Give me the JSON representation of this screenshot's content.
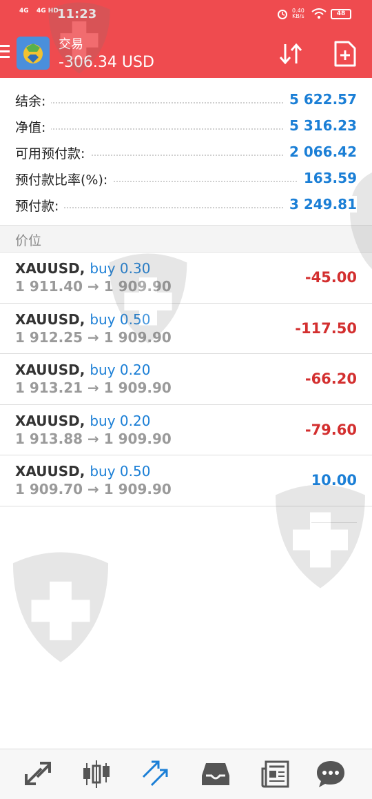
{
  "status_bar": {
    "time": "11:23",
    "network1": "4G",
    "network2": "4G HD",
    "speed_value": "0.40",
    "speed_unit": "KB/s",
    "battery": "48"
  },
  "header": {
    "title": "交易",
    "profit": "-306.34 USD",
    "accent": "#ef4b4f"
  },
  "account": [
    {
      "label": "结余:",
      "value": "5 622.57"
    },
    {
      "label": "净值:",
      "value": "5 316.23"
    },
    {
      "label": "可用预付款:",
      "value": "2 066.42"
    },
    {
      "label": "预付款比率(%):",
      "value": "163.59"
    },
    {
      "label": "预付款:",
      "value": "3 249.81"
    }
  ],
  "section_title": "价位",
  "positions": [
    {
      "symbol": "XAUUSD,",
      "side": "buy 0.30",
      "prices": "1 911.40 → 1 909.90",
      "profit": "-45.00",
      "sign": "neg"
    },
    {
      "symbol": "XAUUSD,",
      "side": "buy 0.50",
      "prices": "1 912.25 → 1 909.90",
      "profit": "-117.50",
      "sign": "neg"
    },
    {
      "symbol": "XAUUSD,",
      "side": "buy 0.20",
      "prices": "1 913.21 → 1 909.90",
      "profit": "-66.20",
      "sign": "neg"
    },
    {
      "symbol": "XAUUSD,",
      "side": "buy 0.20",
      "prices": "1 913.88 → 1 909.90",
      "profit": "-79.60",
      "sign": "neg"
    },
    {
      "symbol": "XAUUSD,",
      "side": "buy 0.50",
      "prices": "1 909.70 → 1 909.90",
      "profit": "10.00",
      "sign": "pos"
    }
  ],
  "bottom_nav": [
    {
      "name": "quotes-icon"
    },
    {
      "name": "chart-icon"
    },
    {
      "name": "trade-icon",
      "active": true
    },
    {
      "name": "history-icon"
    },
    {
      "name": "news-icon"
    },
    {
      "name": "messages-icon"
    }
  ],
  "colors": {
    "blue": "#1b7fd6",
    "red": "#d32f2f"
  }
}
